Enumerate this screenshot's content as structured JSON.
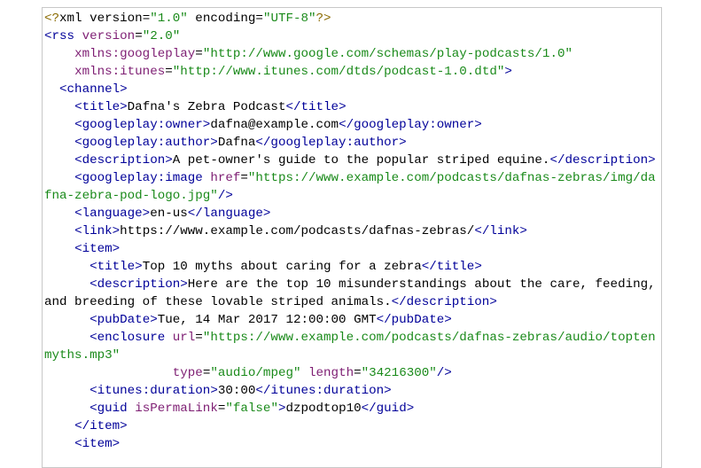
{
  "document": {
    "lines": [
      {
        "indent": "",
        "tokens": [
          {
            "t": "pi",
            "v": "<?"
          },
          {
            "t": "txt",
            "v": "xml "
          },
          {
            "t": "txt",
            "v": "version"
          },
          {
            "t": "txt",
            "v": "="
          },
          {
            "t": "val",
            "v": "\"1.0\""
          },
          {
            "t": "txt",
            "v": " encoding"
          },
          {
            "t": "txt",
            "v": "="
          },
          {
            "t": "val",
            "v": "\"UTF-8\""
          },
          {
            "t": "pi",
            "v": "?>"
          }
        ]
      },
      {
        "indent": "",
        "tokens": [
          {
            "t": "tag",
            "v": "<rss "
          },
          {
            "t": "attr",
            "v": "version"
          },
          {
            "t": "txt",
            "v": "="
          },
          {
            "t": "val",
            "v": "\"2.0\""
          }
        ]
      },
      {
        "indent": "    ",
        "tokens": [
          {
            "t": "attr",
            "v": "xmlns:googleplay"
          },
          {
            "t": "txt",
            "v": "="
          },
          {
            "t": "val",
            "v": "\"http://www.google.com/schemas/play-podcasts/1.0\""
          }
        ]
      },
      {
        "indent": "    ",
        "tokens": [
          {
            "t": "attr",
            "v": "xmlns:itunes"
          },
          {
            "t": "txt",
            "v": "="
          },
          {
            "t": "val",
            "v": "\"http://www.itunes.com/dtds/podcast-1.0.dtd\""
          },
          {
            "t": "tag",
            "v": ">"
          }
        ]
      },
      {
        "indent": "  ",
        "tokens": [
          {
            "t": "tag",
            "v": "<channel>"
          }
        ]
      },
      {
        "indent": "    ",
        "tokens": [
          {
            "t": "tag",
            "v": "<title>"
          },
          {
            "t": "txt",
            "v": "Dafna's Zebra Podcast"
          },
          {
            "t": "tag",
            "v": "</title>"
          }
        ]
      },
      {
        "indent": "    ",
        "tokens": [
          {
            "t": "tag",
            "v": "<googleplay:owner>"
          },
          {
            "t": "txt",
            "v": "dafna@example.com"
          },
          {
            "t": "tag",
            "v": "</googleplay:owner>"
          }
        ]
      },
      {
        "indent": "    ",
        "tokens": [
          {
            "t": "tag",
            "v": "<googleplay:author>"
          },
          {
            "t": "txt",
            "v": "Dafna"
          },
          {
            "t": "tag",
            "v": "</googleplay:author>"
          }
        ]
      },
      {
        "indent": "    ",
        "tokens": [
          {
            "t": "tag",
            "v": "<description>"
          },
          {
            "t": "txt",
            "v": "A pet-owner's guide to the popular striped equine."
          },
          {
            "t": "tag",
            "v": "</description>"
          }
        ]
      },
      {
        "indent": "    ",
        "tokens": [
          {
            "t": "tag",
            "v": "<googleplay:image "
          },
          {
            "t": "attr",
            "v": "href"
          },
          {
            "t": "txt",
            "v": "="
          },
          {
            "t": "val",
            "v": "\"https://www.example.com/podcasts/dafnas-zebras/img/dafna-zebra-pod-logo.jpg\""
          },
          {
            "t": "tag",
            "v": "/>"
          }
        ]
      },
      {
        "indent": "    ",
        "tokens": [
          {
            "t": "tag",
            "v": "<language>"
          },
          {
            "t": "txt",
            "v": "en-us"
          },
          {
            "t": "tag",
            "v": "</language>"
          }
        ]
      },
      {
        "indent": "    ",
        "tokens": [
          {
            "t": "tag",
            "v": "<link>"
          },
          {
            "t": "txt",
            "v": "https://www.example.com/podcasts/dafnas-zebras/"
          },
          {
            "t": "tag",
            "v": "</link>"
          }
        ]
      },
      {
        "indent": "    ",
        "tokens": [
          {
            "t": "tag",
            "v": "<item>"
          }
        ]
      },
      {
        "indent": "      ",
        "tokens": [
          {
            "t": "tag",
            "v": "<title>"
          },
          {
            "t": "txt",
            "v": "Top 10 myths about caring for a zebra"
          },
          {
            "t": "tag",
            "v": "</title>"
          }
        ]
      },
      {
        "indent": "      ",
        "tokens": [
          {
            "t": "tag",
            "v": "<description>"
          },
          {
            "t": "txt",
            "v": "Here are the top 10 misunderstandings about the care, feeding, and breeding of these lovable striped animals."
          },
          {
            "t": "tag",
            "v": "</description>"
          }
        ]
      },
      {
        "indent": "      ",
        "tokens": [
          {
            "t": "tag",
            "v": "<pubDate>"
          },
          {
            "t": "txt",
            "v": "Tue, 14 Mar 2017 12:00:00 GMT"
          },
          {
            "t": "tag",
            "v": "</pubDate>"
          }
        ]
      },
      {
        "indent": "      ",
        "tokens": [
          {
            "t": "tag",
            "v": "<enclosure "
          },
          {
            "t": "attr",
            "v": "url"
          },
          {
            "t": "txt",
            "v": "="
          },
          {
            "t": "val",
            "v": "\"https://www.example.com/podcasts/dafnas-zebras/audio/toptenmyths.mp3\""
          }
        ]
      },
      {
        "indent": "                 ",
        "tokens": [
          {
            "t": "attr",
            "v": "type"
          },
          {
            "t": "txt",
            "v": "="
          },
          {
            "t": "val",
            "v": "\"audio/mpeg\""
          },
          {
            "t": "txt",
            "v": " "
          },
          {
            "t": "attr",
            "v": "length"
          },
          {
            "t": "txt",
            "v": "="
          },
          {
            "t": "val",
            "v": "\"34216300\""
          },
          {
            "t": "tag",
            "v": "/>"
          }
        ]
      },
      {
        "indent": "      ",
        "tokens": [
          {
            "t": "tag",
            "v": "<itunes:duration>"
          },
          {
            "t": "txt",
            "v": "30:00"
          },
          {
            "t": "tag",
            "v": "</itunes:duration>"
          }
        ]
      },
      {
        "indent": "      ",
        "tokens": [
          {
            "t": "tag",
            "v": "<guid "
          },
          {
            "t": "attr",
            "v": "isPermaLink"
          },
          {
            "t": "txt",
            "v": "="
          },
          {
            "t": "val",
            "v": "\"false\""
          },
          {
            "t": "tag",
            "v": ">"
          },
          {
            "t": "txt",
            "v": "dzpodtop10"
          },
          {
            "t": "tag",
            "v": "</guid>"
          }
        ]
      },
      {
        "indent": "    ",
        "tokens": [
          {
            "t": "tag",
            "v": "</item>"
          }
        ]
      },
      {
        "indent": "    ",
        "tokens": [
          {
            "t": "tag",
            "v": "<item>"
          }
        ]
      }
    ]
  },
  "colors": {
    "tag": "#000099",
    "attribute": "#7e1e73",
    "value": "#1a8a1a",
    "processing_instruction": "#8a6a00",
    "text": "#000000",
    "border": "#c8c8c8"
  }
}
